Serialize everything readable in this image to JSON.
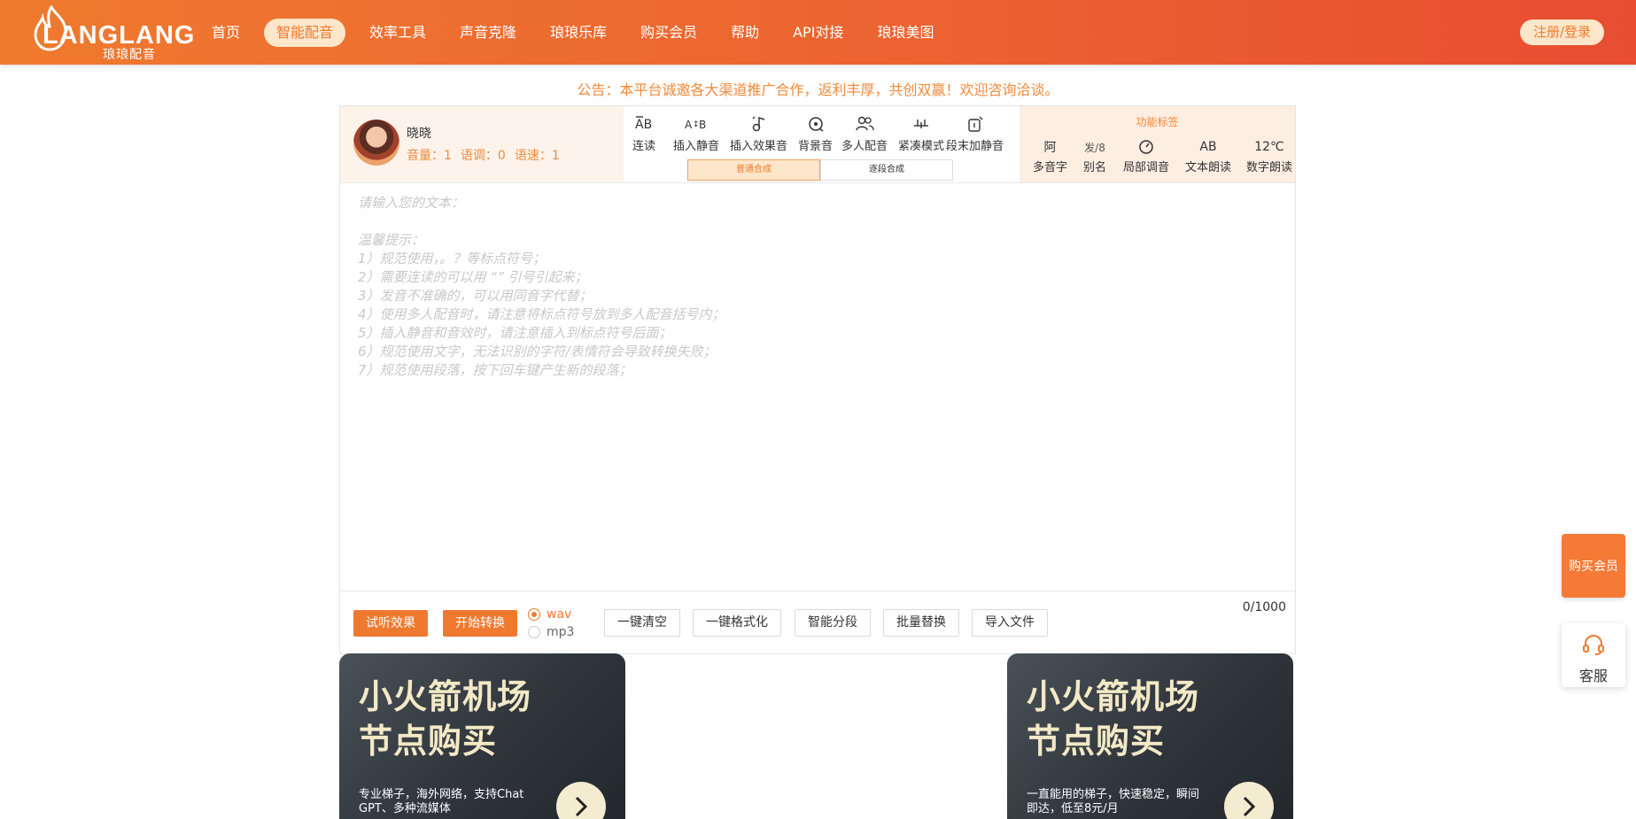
{
  "header": {
    "logo_text": "LANGLANG",
    "logo_sub": "琅琅配音",
    "nav": [
      "首页",
      "智能配音",
      "效率工具",
      "声音克隆",
      "琅琅乐库",
      "购买会员",
      "帮助",
      "API对接",
      "琅琅美图"
    ],
    "active_nav": "智能配音",
    "login_label": "注册/登录"
  },
  "notice": "公告：本平台诚邀各大渠道推广合作，返利丰厚，共创双赢！欢迎咨询洽谈。",
  "voice": {
    "name": "晓晓",
    "volume": "音量：1",
    "pitch": "语调：0",
    "speed": "语速：1"
  },
  "tools": [
    {
      "label": "连读",
      "icon": "ab-link-icon"
    },
    {
      "label": "插入静音",
      "icon": "ab-silence-icon"
    },
    {
      "label": "插入效果音",
      "icon": "music-note-icon"
    },
    {
      "label": "背景音",
      "icon": "background-music-icon"
    },
    {
      "label": "多人配音",
      "icon": "users-icon"
    },
    {
      "label": "紧凑模式",
      "icon": "compact-icon"
    },
    {
      "label": "段末加静音",
      "icon": "paragraph-silence-icon"
    }
  ],
  "mode_tabs": [
    "普通合成",
    "逐段合成"
  ],
  "active_mode": "普通合成",
  "features": {
    "title": "功能标签",
    "items": [
      {
        "label": "多音字",
        "glyph": "阿"
      },
      {
        "label": "别名",
        "glyph": "发/8"
      },
      {
        "label": "局部调音",
        "glyph": ""
      },
      {
        "label": "文本朗读",
        "glyph": "AB"
      },
      {
        "label": "数字朗读",
        "glyph": "12℃"
      }
    ]
  },
  "editor": {
    "placeholder_lines": [
      "请输入您的文本：",
      "",
      "温馨提示：",
      "1）规范使用，。？等标点符号；",
      "2）需要连读的可以用 “” 引号引起来；",
      "3）发音不准确的，可以用同音字代替；",
      "4）使用多人配音时，请注意将标点符号放到多人配音括号内；",
      "5）插入静音和音效时，请注意插入到标点符号后面；",
      "6）规范使用文字，无法识别的字符/表情符会导致转换失败；",
      "7）规范使用段落，按下回车键产生新的段落；"
    ],
    "counter": "0/1000"
  },
  "actions": {
    "preview": "试听效果",
    "convert": "开始转换",
    "formats": [
      "wav",
      "mp3"
    ],
    "selected_format": "wav",
    "buttons": [
      "一键清空",
      "一键格式化",
      "智能分段",
      "批量替换",
      "导入文件"
    ]
  },
  "ads": [
    {
      "title_line1": "小火箭机场",
      "title_line2": "节点购买",
      "desc": "专业梯子，海外网络，支持Chat GPT、多种流媒体"
    },
    {
      "title_line1": "小火箭机场",
      "title_line2": "节点购买",
      "desc": "一直能用的梯子，快速稳定，瞬间即达，低至8元/月"
    }
  ],
  "float": {
    "buy": "购买会员",
    "service": "客服"
  },
  "colors": {
    "brand": "#ef7a2f",
    "brand_light": "#fde6c9",
    "notice": "#f08a3b"
  }
}
